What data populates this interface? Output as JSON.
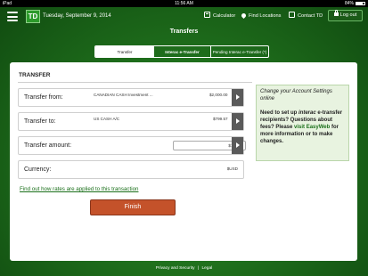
{
  "status_bar": {
    "device": "iPad",
    "time": "11:56 AM",
    "battery": "84%"
  },
  "header": {
    "logo_text": "TD",
    "date": "Tuesday, September 9, 2014",
    "links": {
      "calculator": "Calculator",
      "find_locations": "Find Locations",
      "contact": "Contact TD"
    },
    "logout": "Log out"
  },
  "page_title": "Transfers",
  "tabs": {
    "transfer": "Transfer",
    "interac_transfer": "Interac e-Transfer",
    "pending_interac": "Pending Interac e-Transfer (*)"
  },
  "form": {
    "section_title": "TRANSFER",
    "transfer_from": {
      "label": "Transfer from:",
      "account": "CANADIAN CASH Investment ...",
      "amount": "$2,000.00"
    },
    "transfer_to": {
      "label": "Transfer to:",
      "account": "US CASH A/C",
      "amount": "$799.57"
    },
    "transfer_amount": {
      "label": "Transfer amount:",
      "value": "$100.00"
    },
    "currency": {
      "label": "Currency:",
      "value": "$USD"
    },
    "rates_link": "Find out how rates are applied to this transaction",
    "finish": "Finish"
  },
  "help": {
    "heading": "Change your Account Settings online",
    "prefix": "Need to set up ",
    "interac_word": "interac",
    "middle": " e-transfer recipients? Questions about fees? Please ",
    "link": "visit EasyWeb",
    "suffix": " for more information or to make changes."
  },
  "footer": {
    "privacy": "Privacy and Security",
    "separator": "|",
    "legal": "Legal"
  },
  "colors": {
    "green_bg": "#1f6f1c",
    "finish_button": "#c4522a",
    "link": "#1a6f1a",
    "help_bg": "#e8f3e0"
  }
}
